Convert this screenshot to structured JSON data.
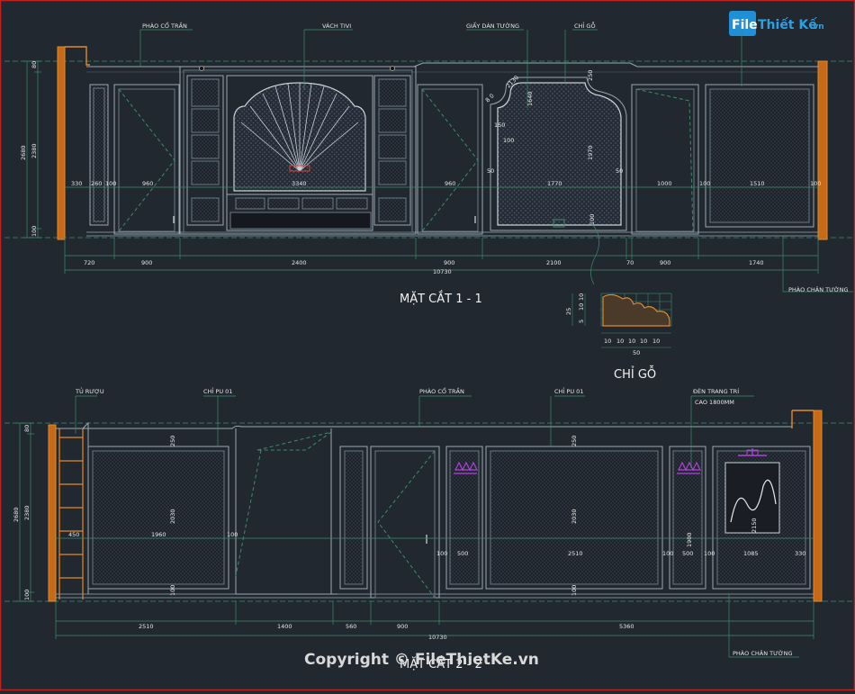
{
  "logo": {
    "text_file": "File",
    "text_rest": "Thiết Kế",
    "text_domain": ".vn"
  },
  "section1": {
    "title": "MẶT CẮT 1 - 1",
    "labels": {
      "phao_co_tran": "PHÀO CỔ TRẦN",
      "vach_tivi": "VÁCH TIVI",
      "giay_dan_tuong": "GIẤY DÁN TƯỜNG",
      "chi_go": "CHỈ GỖ",
      "phao_chan_tuong": "PHÀO CHÂN TƯỜNG"
    },
    "heights": {
      "total": "2680",
      "main": "2380",
      "top": "80",
      "bottom": "100"
    },
    "inner_dims": [
      "330",
      "260",
      "100",
      "960",
      "3340",
      "960",
      "50",
      "1770",
      "50",
      "1000",
      "100",
      "1510",
      "100"
    ],
    "niche_dims": [
      "2130",
      "1640",
      "1970",
      "100",
      "150",
      "8 0",
      "100",
      "250"
    ],
    "bottom_dims": [
      "720",
      "900",
      "2400",
      "900",
      "2100",
      "70",
      "900",
      "1740"
    ],
    "total_width": "10730"
  },
  "detail": {
    "title": "CHỈ GỖ",
    "vdims": [
      "25",
      "10",
      "10",
      "5"
    ],
    "hdims": [
      "10",
      "10",
      "10",
      "10",
      "10"
    ],
    "total": "50"
  },
  "section2": {
    "title": "MẶT CẮT 2 - 2",
    "labels": {
      "tu_ruou": "TỦ RƯỢU",
      "chi_pu_left": "CHỈ PU 01",
      "phao_co_tran": "PHÀO CỔ TRẦN",
      "chi_pu_right": "CHỈ PU 01",
      "den_trang_tri": "ĐÈN TRANG TRÍ",
      "cao": "CAO 1800MM",
      "phao_chan_tuong": "PHÀO CHÂN TƯỜNG"
    },
    "heights": {
      "total": "2680",
      "main": "2380",
      "top": "80",
      "bottom": "100"
    },
    "inner_dims": [
      "450",
      "1960",
      "100",
      "100",
      "500",
      "2510",
      "100",
      "500",
      "100",
      "1085",
      "330"
    ],
    "vert_dims": [
      "250",
      "2030",
      "100",
      "250",
      "2030",
      "100",
      "1900",
      "2150"
    ],
    "bottom_dims": [
      "2510",
      "1400",
      "560",
      "900",
      "5360"
    ],
    "total_width": "10730"
  },
  "watermark": "Copyright © FileThietKe.vn"
}
